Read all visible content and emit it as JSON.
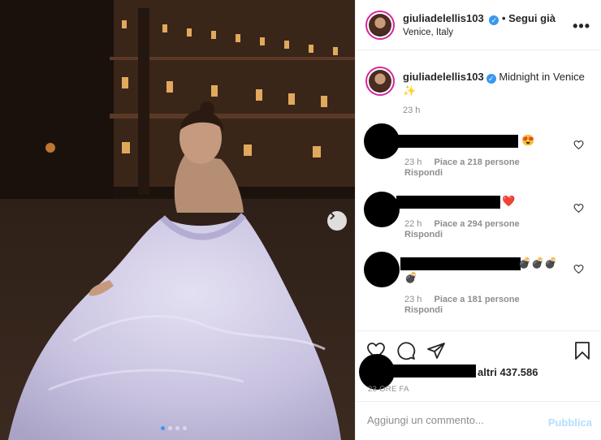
{
  "post": {
    "username": "giuliadelellis103",
    "follow_label": "• Segui già",
    "location": "Venice, Italy",
    "more_label": "•••"
  },
  "caption": {
    "username": "giuliadelellis103",
    "text": "Midnight in Venice ✨",
    "time": "23 h"
  },
  "comments": [
    {
      "emoji": "😍",
      "time": "23 h",
      "likes": "Piace a 218 persone",
      "reply": "Rispondi"
    },
    {
      "emoji": "❤️",
      "time": "22 h",
      "likes": "Piace a 294 persone",
      "reply": "Rispondi"
    },
    {
      "emoji": "💣💣💣",
      "emoji2": "💣",
      "time": "23 h",
      "likes": "Piace a 181 persone",
      "reply": "Rispondi"
    }
  ],
  "likes": {
    "text": "altri 437.586"
  },
  "post_time": "23 ORE FA",
  "composer": {
    "placeholder": "Aggiungi un commento...",
    "publish_label": "Pubblica"
  },
  "colors": {
    "accent": "#3897f0",
    "publish_disabled": "#b2dffc",
    "muted": "#8e8e8e"
  },
  "icons": [
    "chevron-right-icon",
    "heart-icon",
    "comment-icon",
    "share-icon",
    "bookmark-icon",
    "verified-icon",
    "more-icon"
  ]
}
